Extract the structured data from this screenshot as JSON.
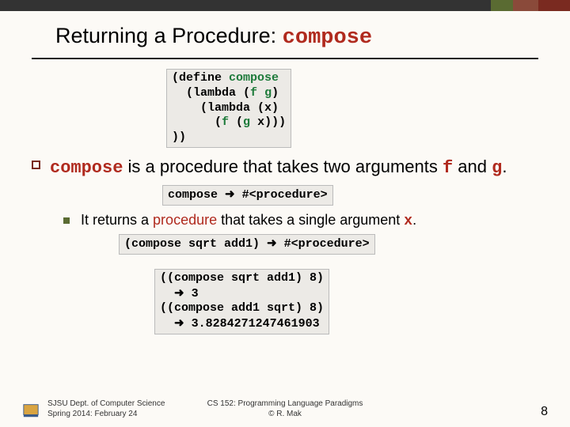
{
  "title_prefix": "Returning a Procedure: ",
  "title_code": "compose",
  "code_block1": {
    "l1a": "(define ",
    "l1b": "compose",
    "l2a": "  (lambda (",
    "l2b": "f",
    "l2c": " ",
    "l2d": "g",
    "l2e": ")",
    "l3": "    (lambda (x)",
    "l4a": "      (",
    "l4b": "f",
    "l4c": " (",
    "l4d": "g",
    "l4e": " x)))",
    "l5": "))"
  },
  "para1": {
    "a": "compose",
    "b": " is a procedure that takes two arguments ",
    "c": "f",
    "d": " and ",
    "e": "g",
    "f": "."
  },
  "code_block2": {
    "a": "compose ",
    "arrow": "➜",
    "b": " #<procedure>"
  },
  "para2": {
    "a": "It returns a ",
    "b": "procedure",
    "c": " that takes a single argument ",
    "d": "x",
    "e": "."
  },
  "code_block3": {
    "a": "(compose sqrt add1) ",
    "arrow": "➜",
    "b": " #<procedure>"
  },
  "code_block4": {
    "l1": "((compose sqrt add1) 8)",
    "l2a": "  ",
    "l2arrow": "➜",
    "l2b": " 3",
    "l3": "((compose add1 sqrt) 8)",
    "l4a": "  ",
    "l4arrow": "➜",
    "l4b": " 3.8284271247461903"
  },
  "footer": {
    "left1": "SJSU Dept. of Computer Science",
    "left2": "Spring 2014: February 24",
    "center1": "CS 152: Programming Language Paradigms",
    "center2": "© R. Mak",
    "page": "8"
  }
}
